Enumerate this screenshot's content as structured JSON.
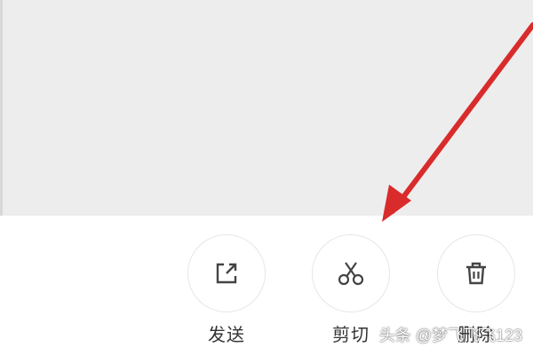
{
  "actions": [
    {
      "label": "发送",
      "icon": "share-icon"
    },
    {
      "label": "剪切",
      "icon": "scissors-icon"
    },
    {
      "label": "删除",
      "icon": "trash-icon"
    }
  ],
  "watermark": "头条 @梦飞飞飞123",
  "colors": {
    "top_panel": "#ededed",
    "bottom_bar": "#ffffff",
    "arrow": "#d92b2b",
    "icon": "#444444",
    "label": "#333333"
  }
}
